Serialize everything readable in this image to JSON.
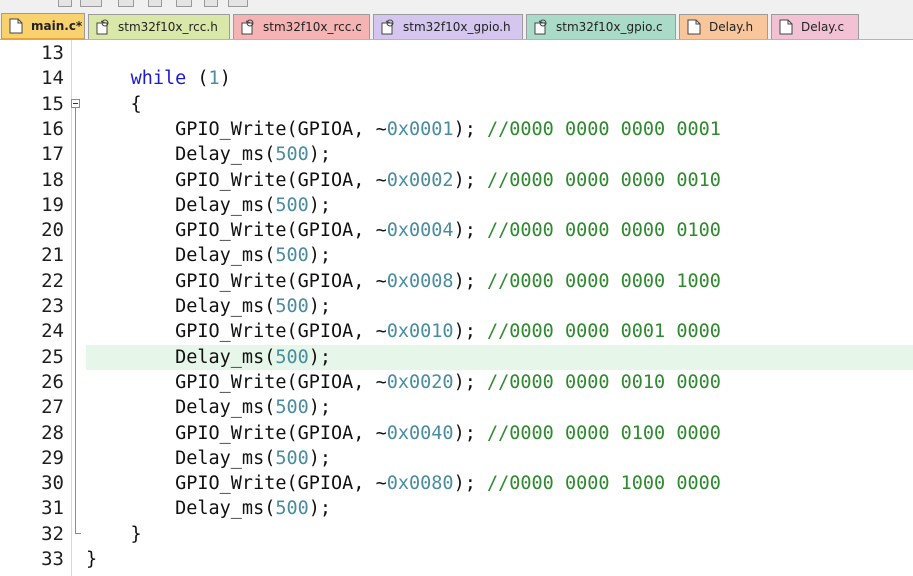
{
  "tabs": [
    {
      "label": "main.c*",
      "bg": "#f7d26e",
      "icon": "file-icon",
      "active": true
    },
    {
      "label": "stm32f10x_rcc.h",
      "bg": "#d9e8a8",
      "icon": "header-file-icon"
    },
    {
      "label": "stm32f10x_rcc.c",
      "bg": "#f6b3b3",
      "icon": "source-file-icon"
    },
    {
      "label": "stm32f10x_gpio.h",
      "bg": "#d4c6ee",
      "icon": "header-file-icon"
    },
    {
      "label": "stm32f10x_gpio.c",
      "bg": "#a9dbc8",
      "icon": "source-file-icon"
    },
    {
      "label": "Delay.h",
      "bg": "#f8c69a",
      "icon": "file-icon"
    },
    {
      "label": "Delay.c",
      "bg": "#f2c2d4",
      "icon": "file-icon"
    }
  ],
  "editor": {
    "current_line": "25",
    "lines": [
      {
        "n": "13",
        "segs": []
      },
      {
        "n": "14",
        "segs": [
          {
            "t": "    "
          },
          {
            "t": "while",
            "c": "kw"
          },
          {
            "t": " (",
            "c": ""
          },
          {
            "t": "1",
            "c": "num"
          },
          {
            "t": ")"
          }
        ]
      },
      {
        "n": "15",
        "segs": [
          {
            "t": "    {"
          }
        ]
      },
      {
        "n": "16",
        "segs": [
          {
            "t": "        GPIO_Write(GPIOA, ~"
          },
          {
            "t": "0x0001",
            "c": "num"
          },
          {
            "t": "); "
          },
          {
            "t": "//0000 0000 0000 0001",
            "c": "cm"
          }
        ]
      },
      {
        "n": "17",
        "segs": [
          {
            "t": "        Delay_ms("
          },
          {
            "t": "500",
            "c": "num"
          },
          {
            "t": ");"
          }
        ]
      },
      {
        "n": "18",
        "segs": [
          {
            "t": "        GPIO_Write(GPIOA, ~"
          },
          {
            "t": "0x0002",
            "c": "num"
          },
          {
            "t": "); "
          },
          {
            "t": "//0000 0000 0000 0010",
            "c": "cm"
          }
        ]
      },
      {
        "n": "19",
        "segs": [
          {
            "t": "        Delay_ms("
          },
          {
            "t": "500",
            "c": "num"
          },
          {
            "t": ");"
          }
        ]
      },
      {
        "n": "20",
        "segs": [
          {
            "t": "        GPIO_Write(GPIOA, ~"
          },
          {
            "t": "0x0004",
            "c": "num"
          },
          {
            "t": "); "
          },
          {
            "t": "//0000 0000 0000 0100",
            "c": "cm"
          }
        ]
      },
      {
        "n": "21",
        "segs": [
          {
            "t": "        Delay_ms("
          },
          {
            "t": "500",
            "c": "num"
          },
          {
            "t": ");"
          }
        ]
      },
      {
        "n": "22",
        "segs": [
          {
            "t": "        GPIO_Write(GPIOA, ~"
          },
          {
            "t": "0x0008",
            "c": "num"
          },
          {
            "t": "); "
          },
          {
            "t": "//0000 0000 0000 1000",
            "c": "cm"
          }
        ]
      },
      {
        "n": "23",
        "segs": [
          {
            "t": "        Delay_ms("
          },
          {
            "t": "500",
            "c": "num"
          },
          {
            "t": ");"
          }
        ]
      },
      {
        "n": "24",
        "segs": [
          {
            "t": "        GPIO_Write(GPIOA, ~"
          },
          {
            "t": "0x0010",
            "c": "num"
          },
          {
            "t": "); "
          },
          {
            "t": "//0000 0000 0001 0000",
            "c": "cm"
          }
        ]
      },
      {
        "n": "25",
        "segs": [
          {
            "t": "        Delay_ms("
          },
          {
            "t": "500",
            "c": "num"
          },
          {
            "t": ");"
          }
        ]
      },
      {
        "n": "26",
        "segs": [
          {
            "t": "        GPIO_Write(GPIOA, ~"
          },
          {
            "t": "0x0020",
            "c": "num"
          },
          {
            "t": "); "
          },
          {
            "t": "//0000 0000 0010 0000",
            "c": "cm"
          }
        ]
      },
      {
        "n": "27",
        "segs": [
          {
            "t": "        Delay_ms("
          },
          {
            "t": "500",
            "c": "num"
          },
          {
            "t": ");"
          }
        ]
      },
      {
        "n": "28",
        "segs": [
          {
            "t": "        GPIO_Write(GPIOA, ~"
          },
          {
            "t": "0x0040",
            "c": "num"
          },
          {
            "t": "); "
          },
          {
            "t": "//0000 0000 0100 0000",
            "c": "cm"
          }
        ]
      },
      {
        "n": "29",
        "segs": [
          {
            "t": "        Delay_ms("
          },
          {
            "t": "500",
            "c": "num"
          },
          {
            "t": ");"
          }
        ]
      },
      {
        "n": "30",
        "segs": [
          {
            "t": "        GPIO_Write(GPIOA, ~"
          },
          {
            "t": "0x0080",
            "c": "num"
          },
          {
            "t": "); "
          },
          {
            "t": "//0000 0000 1000 0000",
            "c": "cm"
          }
        ]
      },
      {
        "n": "31",
        "segs": [
          {
            "t": "        Delay_ms("
          },
          {
            "t": "500",
            "c": "num"
          },
          {
            "t": ");"
          }
        ]
      },
      {
        "n": "32",
        "segs": [
          {
            "t": "    }"
          }
        ]
      },
      {
        "n": "33",
        "segs": [
          {
            "t": "}"
          }
        ]
      }
    ]
  }
}
